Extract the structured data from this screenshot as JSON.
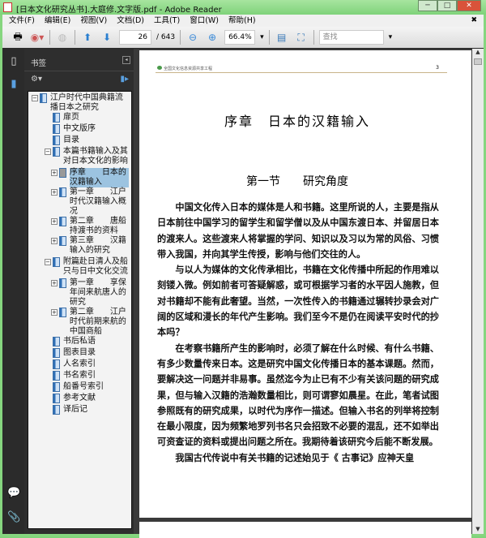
{
  "window": {
    "title": "[日本文化研究丛书].大庭修.文字版.pdf - Adobe Reader"
  },
  "menu": [
    "文件(F)",
    "编辑(E)",
    "视图(V)",
    "文档(D)",
    "工具(T)",
    "窗口(W)",
    "帮助(H)"
  ],
  "toolbar": {
    "page_current": "26",
    "page_total": "/ 643",
    "zoom": "66.4%",
    "search_placeholder": "查找"
  },
  "bookmarks": {
    "title": "书签",
    "items": [
      {
        "label": "江户时代中国典籍流播日本之研究",
        "level": 0,
        "expand": "−"
      },
      {
        "label": "扉页",
        "level": 1
      },
      {
        "label": "中文版序",
        "level": 1
      },
      {
        "label": "目录",
        "level": 1
      },
      {
        "label": "本篇书籍输入及其对日本文化的影响",
        "level": 1,
        "expand": "−"
      },
      {
        "label": "序章　　日本的汉籍输入",
        "level": 2,
        "expand": "+",
        "selected": true
      },
      {
        "label": "第一章　　江户时代汉籍输入概况",
        "level": 2,
        "expand": "+"
      },
      {
        "label": "第二章　　唐船持渡书的资料",
        "level": 2,
        "expand": "+"
      },
      {
        "label": "第三章　　汉籍输入的研究",
        "level": 2,
        "expand": "+"
      },
      {
        "label": "附篇赴日清人及船只与日中文化交流",
        "level": 1,
        "expand": "−"
      },
      {
        "label": "第一章　　享保年间来航唐人的研究",
        "level": 2,
        "expand": "+"
      },
      {
        "label": "第二章　　江户时代前期来航的中国商船",
        "level": 2,
        "expand": "+"
      },
      {
        "label": "书后私语",
        "level": 1
      },
      {
        "label": "图表目录",
        "level": 1
      },
      {
        "label": "人名索引",
        "level": 1
      },
      {
        "label": "书名索引",
        "level": 1
      },
      {
        "label": "船番号索引",
        "level": 1
      },
      {
        "label": "参考文献",
        "level": 1
      },
      {
        "label": "译后记",
        "level": 1
      }
    ]
  },
  "page": {
    "header": "全国文化信息资源共享工程",
    "number": "3",
    "chapter": "序章　日本的汉籍输入",
    "section": "第一节　　研究角度",
    "paragraphs": [
      "中国文化传入日本的媒体是人和书籍。这里所说的人，主要是指从日本前往中国学习的留学生和留学僧以及从中国东渡日本、并留居日本的渡来人。这些渡来人将掌握的学问、知识以及习以为常的风俗、习惯带入我国，并向其学生传授，影响与他们交往的人。",
      "与以人为媒体的文化传承相比，书籍在文化传播中所起的作用难以刻镂入微。例如前者可答疑解惑，或可根据学习者的水平因人施教，但对书籍却不能有此奢望。当然，一次性传入的书籍通过辗转抄录会对广阔的区域和漫长的年代产生影响。我们至今不是仍在阅读平安时代的抄本吗？",
      "在考察书籍所产生的影响时，必须了解在什么时候、有什么书籍、有多少数量传来日本。这是研究中国文化传播日本的基本课题。然而，要解决这一问题并非易事。虽然迄今为止已有不少有关该问题的研究成果，但与输入汉籍的浩瀚数量相比，则可谓寥如晨星。在此，笔者试图参照既有的研究成果，以时代为序作一描述。但输入书名的列举将控制在最小限度，因为频繁地罗列书名只会招致不必要的混乱，还不如举出可资查证的资料或提出问题之所在。我期待着该研究今后能不断发展。",
      "我国古代传说中有关书籍的记述始见于《 古事记》应神天皇"
    ]
  }
}
